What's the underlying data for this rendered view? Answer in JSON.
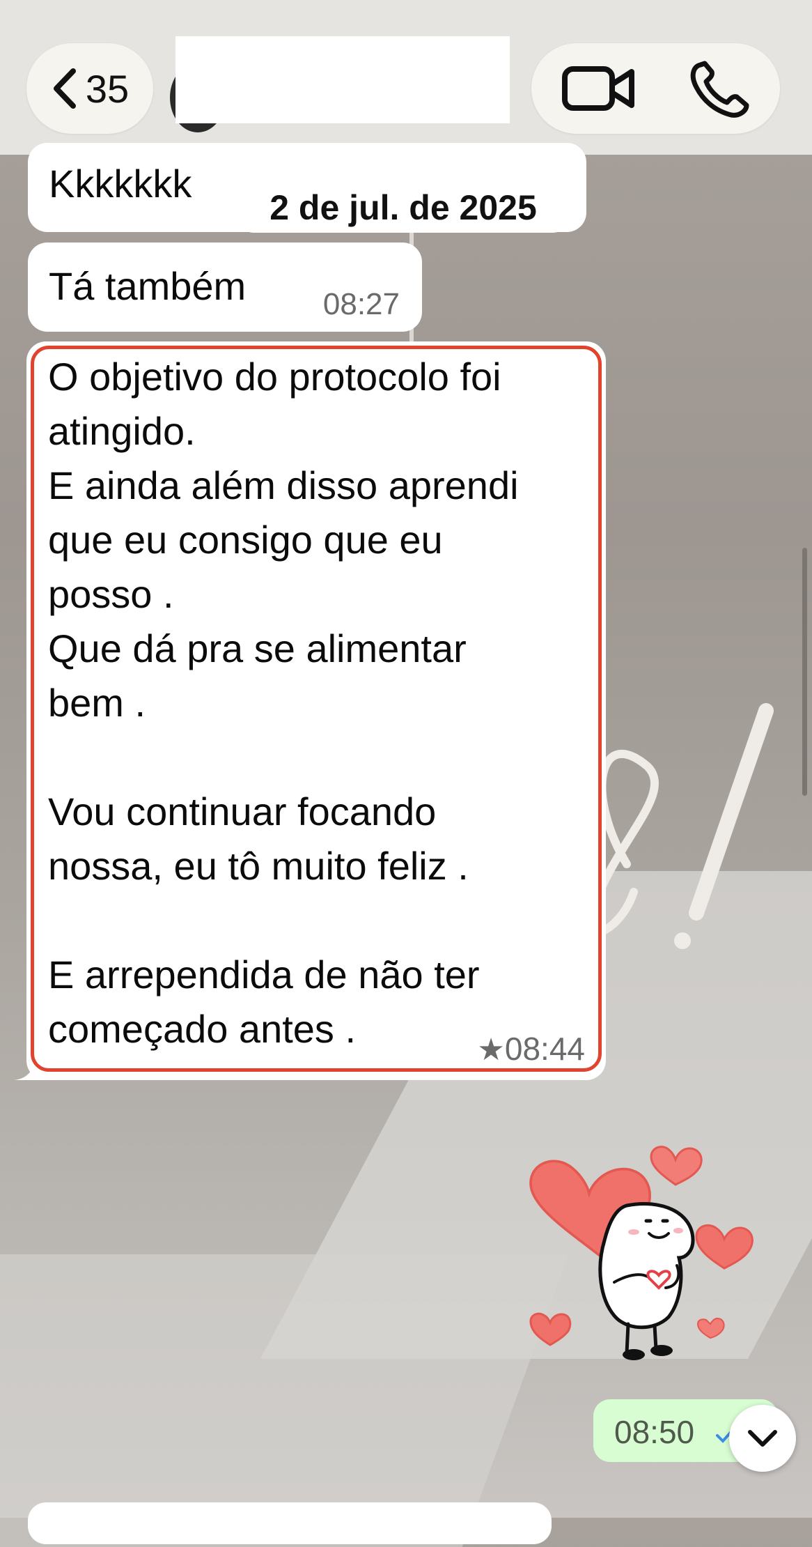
{
  "header": {
    "back_count": "35",
    "contact_name": ""
  },
  "date_separator": "2 de jul. de 2025",
  "messages": [
    {
      "text": "Kkkkkkk",
      "time": ""
    },
    {
      "text": "Tá também",
      "time": "08:27"
    },
    {
      "text": "O objetivo do protocolo foi\natingido.\nE ainda além disso aprendi\nque eu consigo que eu\nposso .\nQue dá pra se alimentar\nbem .\n\nVou continuar focando\nnossa, eu tô muito feliz .\n\nE arrependida de não ter\ncomeçado antes .",
      "starred": true,
      "star_symbol": "★",
      "time": "08:44"
    }
  ],
  "sticker": {
    "type": "blob-with-hearts-sticker"
  },
  "sent_message": {
    "time": "08:50",
    "status": "read"
  },
  "colors": {
    "received_bubble": "#ffffff",
    "sent_bubble": "#d8fdd2",
    "highlight_border": "#e0442f",
    "read_check": "#3a8ee6"
  }
}
